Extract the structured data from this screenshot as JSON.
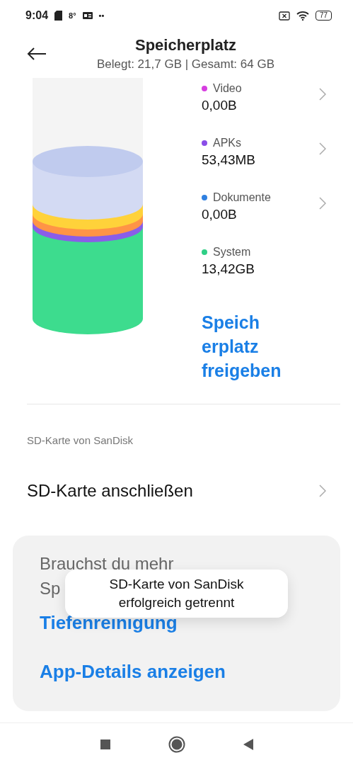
{
  "status_bar": {
    "time": "9:04",
    "temperature": "8°",
    "dots": "••",
    "battery": "77"
  },
  "header": {
    "title": "Speicherplatz",
    "subtitle": "Belegt: 21,7 GB | Gesamt: 64 GB"
  },
  "categories": [
    {
      "name": "Video",
      "size": "0,00B",
      "color": "#d63ee0",
      "has_chevron": true
    },
    {
      "name": "APKs",
      "size": "53,43MB",
      "color": "#8a4de8",
      "has_chevron": true
    },
    {
      "name": "Dokumente",
      "size": "0,00B",
      "color": "#2f80e0",
      "has_chevron": true
    },
    {
      "name": "System",
      "size": "13,42GB",
      "color": "#2fcf86",
      "has_chevron": false
    }
  ],
  "free_up_link": [
    "Speich",
    "erplatz",
    "freigeben"
  ],
  "sd_section": {
    "label": "SD-Karte von SanDisk",
    "row": "SD-Karte anschließen"
  },
  "card": {
    "heading": [
      "Brauchst du mehr",
      "Sp"
    ],
    "links": [
      "Tiefenreinigung",
      "App-Details anzeigen"
    ]
  },
  "toast": {
    "lines": [
      "SD-Karte von SanDisk",
      "erfolgreich getrennt"
    ]
  }
}
